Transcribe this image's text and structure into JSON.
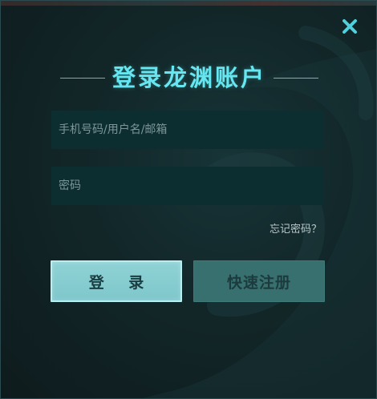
{
  "dialog": {
    "title": "登录龙渊账户",
    "close_icon": "close-icon",
    "account_field": {
      "placeholder": "手机号码/用户名/邮箱",
      "value": ""
    },
    "password_field": {
      "placeholder": "密码",
      "value": ""
    },
    "forgot_password_label": "忘记密码？",
    "login_button_label": "登 录",
    "register_button_label": "快速注册"
  },
  "colors": {
    "accent": "#66e6f0",
    "close": "#4fd0dc",
    "panel_bg": "#132a2c",
    "field_bg": "#0d2e31",
    "login_bg": "#85cdd0",
    "register_bg": "#38706f"
  }
}
